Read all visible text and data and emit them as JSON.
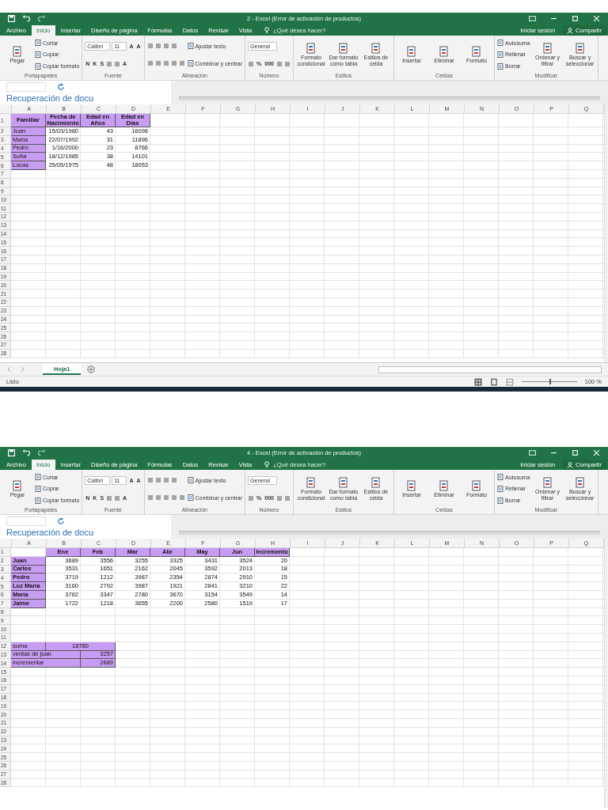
{
  "windows": [
    {
      "title": "2 - Excel (Error de activación de productos)",
      "ribbon_tabs": [
        {
          "label": "Archivo",
          "selected": false
        },
        {
          "label": "Inicio",
          "selected": true
        },
        {
          "label": "Insertar",
          "selected": false
        },
        {
          "label": "Diseño de página",
          "selected": false
        },
        {
          "label": "Fórmulas",
          "selected": false
        },
        {
          "label": "Datos",
          "selected": false
        },
        {
          "label": "Revisar",
          "selected": false
        },
        {
          "label": "Vista",
          "selected": false
        }
      ],
      "tell_me": "¿Qué desea hacer?",
      "sign_in": "Iniciar sesión",
      "share": "Compartir",
      "ribbon_groups": [
        {
          "label": "Portapapeles",
          "columns": [
            [
              [
                {
                  "kind": "large",
                  "label": "Pegar"
                }
              ]
            ],
            [
              [
                {
                  "kind": "small",
                  "label": "Cortar"
                }
              ],
              [
                {
                  "kind": "small",
                  "label": "Copiar"
                }
              ],
              [
                {
                  "kind": "small",
                  "label": "Copiar formato"
                }
              ]
            ]
          ]
        },
        {
          "label": "Fuente",
          "columns": [
            [
              [
                {
                  "kind": "combo",
                  "value": "Calibri"
                },
                {
                  "kind": "combo",
                  "value": "11"
                },
                {
                  "kind": "glyph",
                  "label": "A"
                },
                {
                  "kind": "glyph",
                  "label": "A"
                }
              ],
              [
                {
                  "kind": "glyph",
                  "label": "N"
                },
                {
                  "kind": "glyph",
                  "label": "K"
                },
                {
                  "kind": "glyph",
                  "label": "S"
                },
                {
                  "kind": "icon"
                },
                {
                  "kind": "icon"
                },
                {
                  "kind": "glyph",
                  "label": "A"
                }
              ]
            ]
          ]
        },
        {
          "label": "Alineación",
          "columns": [
            [
              [
                {
                  "kind": "icon"
                },
                {
                  "kind": "icon"
                },
                {
                  "kind": "icon"
                },
                {
                  "kind": "icon"
                }
              ],
              [
                {
                  "kind": "icon"
                },
                {
                  "kind": "icon"
                },
                {
                  "kind": "icon"
                },
                {
                  "kind": "icon"
                },
                {
                  "kind": "icon"
                }
              ]
            ],
            [
              [
                {
                  "kind": "small",
                  "label": "Ajustar texto"
                }
              ],
              [
                {
                  "kind": "small",
                  "label": "Combinar y centrar"
                }
              ]
            ]
          ]
        },
        {
          "label": "Número",
          "columns": [
            [
              [
                {
                  "kind": "combo",
                  "value": "General"
                }
              ],
              [
                {
                  "kind": "icon"
                },
                {
                  "kind": "glyph",
                  "label": "%"
                },
                {
                  "kind": "glyph",
                  "label": "000"
                },
                {
                  "kind": "icon"
                },
                {
                  "kind": "icon"
                }
              ]
            ]
          ]
        },
        {
          "label": "Estilos",
          "columns": [
            [
              [
                {
                  "kind": "large",
                  "label": "Formato condicional"
                }
              ]
            ],
            [
              [
                {
                  "kind": "large",
                  "label": "Dar formato como tabla"
                }
              ]
            ],
            [
              [
                {
                  "kind": "large",
                  "label": "Estilos de celda"
                }
              ]
            ]
          ]
        },
        {
          "label": "Celdas",
          "columns": [
            [
              [
                {
                  "kind": "large",
                  "label": "Insertar"
                }
              ]
            ],
            [
              [
                {
                  "kind": "large",
                  "label": "Eliminar"
                }
              ]
            ],
            [
              [
                {
                  "kind": "large",
                  "label": "Formato"
                }
              ]
            ]
          ]
        },
        {
          "label": "Modificar",
          "columns": [
            [
              [
                {
                  "kind": "small",
                  "label": "Autosuma"
                }
              ],
              [
                {
                  "kind": "small",
                  "label": "Rellenar"
                }
              ],
              [
                {
                  "kind": "small",
                  "label": "Borrar"
                }
              ]
            ],
            [
              [
                {
                  "kind": "large",
                  "label": "Ordenar y filtrar"
                }
              ]
            ],
            [
              [
                {
                  "kind": "large",
                  "label": "Buscar y seleccionar"
                }
              ]
            ]
          ]
        }
      ],
      "recovery": "Recuperación de docu",
      "columns": [
        "A",
        "B",
        "C",
        "D",
        "E",
        "F",
        "G",
        "H",
        "I",
        "J",
        "K",
        "L",
        "M",
        "N",
        "O",
        "P",
        "Q"
      ],
      "rows": [
        {
          "number": "1",
          "cells": [
            {
              "text": "Familiar",
              "kind": "header",
              "highlighted": true,
              "bold": true
            },
            {
              "text": "Fecha de Nacimiento",
              "kind": "header",
              "highlighted": true,
              "bold": true
            },
            {
              "text": "Edad en Años",
              "kind": "header",
              "highlighted": true,
              "bold": true
            },
            {
              "text": "Edad en Días",
              "kind": "header",
              "highlighted": true,
              "bold": true
            }
          ]
        },
        {
          "number": "2",
          "cells": [
            {
              "text": "Juan",
              "kind": "label",
              "highlighted": true,
              "bold": false
            },
            {
              "text": "15/03/1980",
              "kind": "number",
              "highlighted": false,
              "bold": false
            },
            {
              "text": "43",
              "kind": "number",
              "highlighted": false,
              "bold": false
            },
            {
              "text": "16098",
              "kind": "number",
              "highlighted": false,
              "bold": false
            }
          ]
        },
        {
          "number": "3",
          "cells": [
            {
              "text": "María",
              "kind": "label",
              "highlighted": true,
              "bold": false
            },
            {
              "text": "22/07/1992",
              "kind": "number",
              "highlighted": false,
              "bold": false
            },
            {
              "text": "31",
              "kind": "number",
              "highlighted": false,
              "bold": false
            },
            {
              "text": "11896",
              "kind": "number",
              "highlighted": false,
              "bold": false
            }
          ]
        },
        {
          "number": "4",
          "cells": [
            {
              "text": "Pedro",
              "kind": "label",
              "highlighted": true,
              "bold": false
            },
            {
              "text": "1/16/2000",
              "kind": "number",
              "highlighted": false,
              "bold": false
            },
            {
              "text": "23",
              "kind": "number",
              "highlighted": false,
              "bold": false
            },
            {
              "text": "8766",
              "kind": "number",
              "highlighted": false,
              "bold": false
            }
          ]
        },
        {
          "number": "5",
          "cells": [
            {
              "text": "Sofía",
              "kind": "label",
              "highlighted": true,
              "bold": false
            },
            {
              "text": "18/12/1985",
              "kind": "number",
              "highlighted": false,
              "bold": false
            },
            {
              "text": "38",
              "kind": "number",
              "highlighted": false,
              "bold": false
            },
            {
              "text": "14101",
              "kind": "number",
              "highlighted": false,
              "bold": false
            }
          ]
        },
        {
          "number": "6",
          "cells": [
            {
              "text": "Lucas",
              "kind": "label",
              "highlighted": true,
              "bold": false
            },
            {
              "text": "25/05/1975",
              "kind": "number",
              "highlighted": false,
              "bold": false
            },
            {
              "text": "48",
              "kind": "number",
              "highlighted": false,
              "bold": false
            },
            {
              "text": "18053",
              "kind": "number",
              "highlighted": false,
              "bold": false
            }
          ]
        },
        {
          "number": "7",
          "cells": []
        },
        {
          "number": "8",
          "cells": []
        },
        {
          "number": "9",
          "cells": []
        },
        {
          "number": "10",
          "cells": []
        },
        {
          "number": "11",
          "cells": []
        },
        {
          "number": "12",
          "cells": []
        },
        {
          "number": "13",
          "cells": []
        },
        {
          "number": "14",
          "cells": []
        },
        {
          "number": "15",
          "cells": []
        },
        {
          "number": "16",
          "cells": []
        },
        {
          "number": "17",
          "cells": []
        },
        {
          "number": "18",
          "cells": []
        },
        {
          "number": "19",
          "cells": []
        },
        {
          "number": "20",
          "cells": []
        },
        {
          "number": "21",
          "cells": []
        },
        {
          "number": "22",
          "cells": []
        },
        {
          "number": "23",
          "cells": []
        },
        {
          "number": "24",
          "cells": []
        },
        {
          "number": "25",
          "cells": []
        },
        {
          "number": "26",
          "cells": []
        },
        {
          "number": "27",
          "cells": []
        },
        {
          "number": "28",
          "cells": []
        }
      ],
      "sheet_tabs": [
        {
          "label": "Hoja1",
          "selected": true
        }
      ],
      "status": {
        "text": "Listo",
        "zoom": "100 %",
        "level": 0.5
      }
    },
    {
      "title": "4 - Excel (Error de activación de productos)",
      "ribbon_tabs": [
        {
          "label": "Archivo",
          "selected": false
        },
        {
          "label": "Inicio",
          "selected": true
        },
        {
          "label": "Insertar",
          "selected": false
        },
        {
          "label": "Diseño de página",
          "selected": false
        },
        {
          "label": "Fórmulas",
          "selected": false
        },
        {
          "label": "Datos",
          "selected": false
        },
        {
          "label": "Revisar",
          "selected": false
        },
        {
          "label": "Vista",
          "selected": false
        }
      ],
      "tell_me": "¿Qué desea hacer?",
      "sign_in": "Iniciar sesión",
      "share": "Compartir",
      "ribbon_groups": [
        {
          "label": "Portapapeles",
          "columns": [
            [
              [
                {
                  "kind": "large",
                  "label": "Pegar"
                }
              ]
            ],
            [
              [
                {
                  "kind": "small",
                  "label": "Cortar"
                }
              ],
              [
                {
                  "kind": "small",
                  "label": "Copiar"
                }
              ],
              [
                {
                  "kind": "small",
                  "label": "Copiar formato"
                }
              ]
            ]
          ]
        },
        {
          "label": "Fuente",
          "columns": [
            [
              [
                {
                  "kind": "combo",
                  "value": "Calibri"
                },
                {
                  "kind": "combo",
                  "value": "11"
                },
                {
                  "kind": "glyph",
                  "label": "A"
                },
                {
                  "kind": "glyph",
                  "label": "A"
                }
              ],
              [
                {
                  "kind": "glyph",
                  "label": "N"
                },
                {
                  "kind": "glyph",
                  "label": "K"
                },
                {
                  "kind": "glyph",
                  "label": "S"
                },
                {
                  "kind": "icon"
                },
                {
                  "kind": "icon"
                },
                {
                  "kind": "glyph",
                  "label": "A"
                }
              ]
            ]
          ]
        },
        {
          "label": "Alineación",
          "columns": [
            [
              [
                {
                  "kind": "icon"
                },
                {
                  "kind": "icon"
                },
                {
                  "kind": "icon"
                },
                {
                  "kind": "icon"
                }
              ],
              [
                {
                  "kind": "icon"
                },
                {
                  "kind": "icon"
                },
                {
                  "kind": "icon"
                },
                {
                  "kind": "icon"
                },
                {
                  "kind": "icon"
                }
              ]
            ],
            [
              [
                {
                  "kind": "small",
                  "label": "Ajustar texto"
                }
              ],
              [
                {
                  "kind": "small",
                  "label": "Combinar y centrar"
                }
              ]
            ]
          ]
        },
        {
          "label": "Número",
          "columns": [
            [
              [
                {
                  "kind": "combo",
                  "value": "General"
                }
              ],
              [
                {
                  "kind": "icon"
                },
                {
                  "kind": "glyph",
                  "label": "%"
                },
                {
                  "kind": "glyph",
                  "label": "000"
                },
                {
                  "kind": "icon"
                },
                {
                  "kind": "icon"
                }
              ]
            ]
          ]
        },
        {
          "label": "Estilos",
          "columns": [
            [
              [
                {
                  "kind": "large",
                  "label": "Formato condicional"
                }
              ]
            ],
            [
              [
                {
                  "kind": "large",
                  "label": "Dar formato como tabla"
                }
              ]
            ],
            [
              [
                {
                  "kind": "large",
                  "label": "Estilos de celda"
                }
              ]
            ]
          ]
        },
        {
          "label": "Celdas",
          "columns": [
            [
              [
                {
                  "kind": "large",
                  "label": "Insertar"
                }
              ]
            ],
            [
              [
                {
                  "kind": "large",
                  "label": "Eliminar"
                }
              ]
            ],
            [
              [
                {
                  "kind": "large",
                  "label": "Formato"
                }
              ]
            ]
          ]
        },
        {
          "label": "Modificar",
          "columns": [
            [
              [
                {
                  "kind": "small",
                  "label": "Autosuma"
                }
              ],
              [
                {
                  "kind": "small",
                  "label": "Rellenar"
                }
              ],
              [
                {
                  "kind": "small",
                  "label": "Borrar"
                }
              ]
            ],
            [
              [
                {
                  "kind": "large",
                  "label": "Ordenar y filtrar"
                }
              ]
            ],
            [
              [
                {
                  "kind": "large",
                  "label": "Buscar y seleccionar"
                }
              ]
            ]
          ]
        }
      ],
      "recovery": "Recuperación de docu",
      "columns": [
        "A",
        "B",
        "C",
        "D",
        "E",
        "F",
        "G",
        "H",
        "I",
        "J",
        "K",
        "L",
        "M",
        "N",
        "O",
        "P",
        "Q"
      ],
      "rows": [
        {
          "number": "1",
          "cells": [
            {
              "kind": "blank"
            },
            {
              "text": "Ene",
              "kind": "header",
              "highlighted": true,
              "bold": true
            },
            {
              "text": "Feb",
              "kind": "header",
              "highlighted": true,
              "bold": true
            },
            {
              "text": "Mar",
              "kind": "header",
              "highlighted": true,
              "bold": true
            },
            {
              "text": "Abr",
              "kind": "header",
              "highlighted": true,
              "bold": true
            },
            {
              "text": "May",
              "kind": "header",
              "highlighted": true,
              "bold": true
            },
            {
              "text": "Jun",
              "kind": "header",
              "highlighted": true,
              "bold": true
            },
            {
              "text": "Incremento",
              "kind": "header",
              "highlighted": true,
              "bold": true
            }
          ]
        },
        {
          "number": "2",
          "cells": [
            {
              "text": "Juan",
              "kind": "label",
              "highlighted": true,
              "bold": true
            },
            {
              "text": "3689",
              "kind": "number",
              "highlighted": false,
              "bold": false
            },
            {
              "text": "3556",
              "kind": "number",
              "highlighted": false,
              "bold": false
            },
            {
              "text": "3255",
              "kind": "number",
              "highlighted": false,
              "bold": false
            },
            {
              "text": "3325",
              "kind": "number",
              "highlighted": false,
              "bold": false
            },
            {
              "text": "3431",
              "kind": "number",
              "highlighted": false,
              "bold": false
            },
            {
              "text": "3524",
              "kind": "number",
              "highlighted": false,
              "bold": false
            },
            {
              "text": "20",
              "kind": "number",
              "highlighted": false,
              "bold": false
            }
          ]
        },
        {
          "number": "3",
          "cells": [
            {
              "text": "Carlos",
              "kind": "label",
              "highlighted": true,
              "bold": true
            },
            {
              "text": "3531",
              "kind": "number",
              "highlighted": false,
              "bold": false
            },
            {
              "text": "1651",
              "kind": "number",
              "highlighted": false,
              "bold": false
            },
            {
              "text": "2162",
              "kind": "number",
              "highlighted": false,
              "bold": false
            },
            {
              "text": "2045",
              "kind": "number",
              "highlighted": false,
              "bold": false
            },
            {
              "text": "3592",
              "kind": "number",
              "highlighted": false,
              "bold": false
            },
            {
              "text": "2013",
              "kind": "number",
              "highlighted": false,
              "bold": false
            },
            {
              "text": "18",
              "kind": "number",
              "highlighted": false,
              "bold": false
            }
          ]
        },
        {
          "number": "4",
          "cells": [
            {
              "text": "Pedro",
              "kind": "label",
              "highlighted": true,
              "bold": true
            },
            {
              "text": "3719",
              "kind": "number",
              "highlighted": false,
              "bold": false
            },
            {
              "text": "1212",
              "kind": "number",
              "highlighted": false,
              "bold": false
            },
            {
              "text": "3987",
              "kind": "number",
              "highlighted": false,
              "bold": false
            },
            {
              "text": "2354",
              "kind": "number",
              "highlighted": false,
              "bold": false
            },
            {
              "text": "2874",
              "kind": "number",
              "highlighted": false,
              "bold": false
            },
            {
              "text": "2910",
              "kind": "number",
              "highlighted": false,
              "bold": false
            },
            {
              "text": "15",
              "kind": "number",
              "highlighted": false,
              "bold": false
            }
          ]
        },
        {
          "number": "5",
          "cells": [
            {
              "text": "Luz María",
              "kind": "label",
              "highlighted": true,
              "bold": true
            },
            {
              "text": "3160",
              "kind": "number",
              "highlighted": false,
              "bold": false
            },
            {
              "text": "2792",
              "kind": "number",
              "highlighted": false,
              "bold": false
            },
            {
              "text": "3987",
              "kind": "number",
              "highlighted": false,
              "bold": false
            },
            {
              "text": "1921",
              "kind": "number",
              "highlighted": false,
              "bold": false
            },
            {
              "text": "2841",
              "kind": "number",
              "highlighted": false,
              "bold": false
            },
            {
              "text": "3210",
              "kind": "number",
              "highlighted": false,
              "bold": false
            },
            {
              "text": "22",
              "kind": "number",
              "highlighted": false,
              "bold": false
            }
          ]
        },
        {
          "number": "6",
          "cells": [
            {
              "text": "María",
              "kind": "label",
              "highlighted": true,
              "bold": true
            },
            {
              "text": "3762",
              "kind": "number",
              "highlighted": false,
              "bold": false
            },
            {
              "text": "3347",
              "kind": "number",
              "highlighted": false,
              "bold": false
            },
            {
              "text": "2780",
              "kind": "number",
              "highlighted": false,
              "bold": false
            },
            {
              "text": "3670",
              "kind": "number",
              "highlighted": false,
              "bold": false
            },
            {
              "text": "3154",
              "kind": "number",
              "highlighted": false,
              "bold": false
            },
            {
              "text": "3549",
              "kind": "number",
              "highlighted": false,
              "bold": false
            },
            {
              "text": "14",
              "kind": "number",
              "highlighted": false,
              "bold": false
            }
          ]
        },
        {
          "number": "7",
          "cells": [
            {
              "text": "Jaime",
              "kind": "label",
              "highlighted": true,
              "bold": true
            },
            {
              "text": "1722",
              "kind": "number",
              "highlighted": false,
              "bold": false
            },
            {
              "text": "1218",
              "kind": "number",
              "highlighted": false,
              "bold": false
            },
            {
              "text": "3655",
              "kind": "number",
              "highlighted": false,
              "bold": false
            },
            {
              "text": "2200",
              "kind": "number",
              "highlighted": false,
              "bold": false
            },
            {
              "text": "2580",
              "kind": "number",
              "highlighted": false,
              "bold": false
            },
            {
              "text": "1519",
              "kind": "number",
              "highlighted": false,
              "bold": false
            },
            {
              "text": "17",
              "kind": "number",
              "highlighted": false,
              "bold": false
            }
          ]
        },
        {
          "number": "8",
          "cells": []
        },
        {
          "number": "9",
          "cells": []
        },
        {
          "number": "10",
          "cells": []
        },
        {
          "number": "11",
          "cells": []
        },
        {
          "number": "12",
          "cells": [
            {
              "text": "suma",
              "kind": "label",
              "highlighted": true,
              "bold": false
            },
            {
              "text": "18780",
              "kind": "wide_header",
              "highlighted": true,
              "bold": false
            }
          ]
        },
        {
          "number": "13",
          "cells": [
            {
              "text": "ventas de juan",
              "kind": "wide_label",
              "highlighted": true,
              "bold": false
            },
            {
              "text": "3257",
              "kind": "number",
              "highlighted": true,
              "bold": false
            }
          ]
        },
        {
          "number": "14",
          "cells": [
            {
              "text": "incrementar",
              "kind": "wide_label",
              "highlighted": true,
              "bold": false
            },
            {
              "text": "2689",
              "kind": "number",
              "highlighted": true,
              "bold": false
            }
          ]
        },
        {
          "number": "15",
          "cells": []
        },
        {
          "number": "16",
          "cells": []
        },
        {
          "number": "17",
          "cells": []
        },
        {
          "number": "18",
          "cells": []
        },
        {
          "number": "19",
          "cells": []
        },
        {
          "number": "20",
          "cells": []
        },
        {
          "number": "21",
          "cells": []
        },
        {
          "number": "22",
          "cells": []
        },
        {
          "number": "23",
          "cells": []
        },
        {
          "number": "24",
          "cells": []
        },
        {
          "number": "25",
          "cells": []
        },
        {
          "number": "26",
          "cells": []
        },
        {
          "number": "27",
          "cells": []
        },
        {
          "number": "28",
          "cells": []
        }
      ]
    }
  ]
}
